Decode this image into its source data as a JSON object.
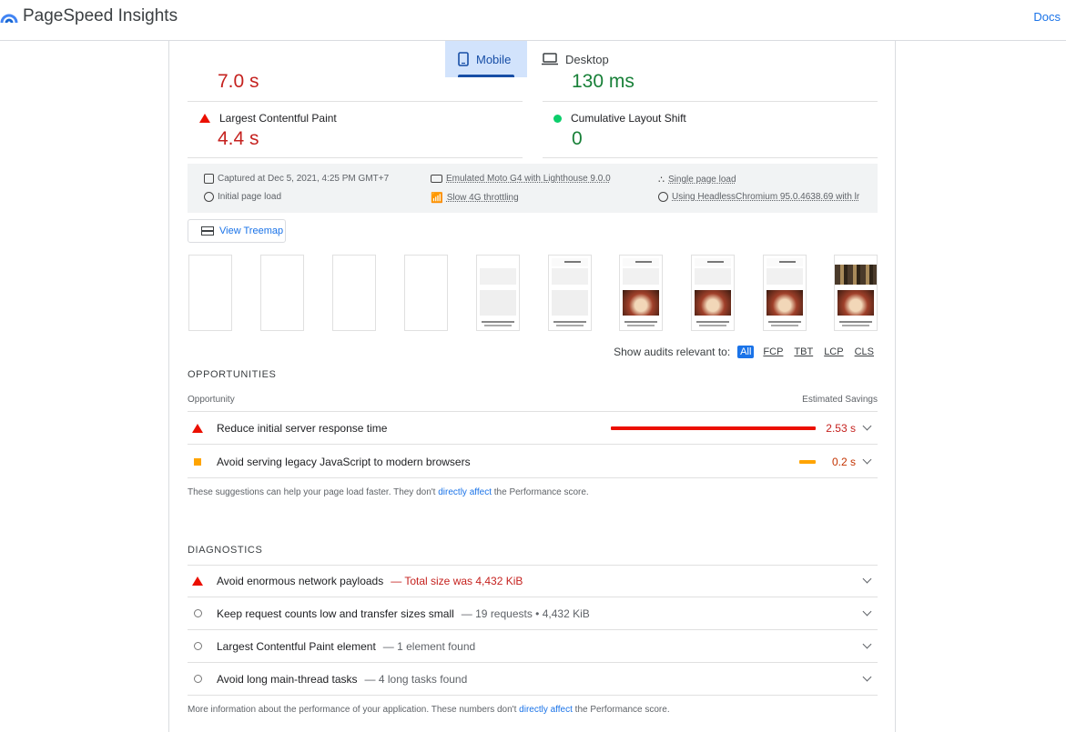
{
  "header": {
    "brand": "PageSpeed Insights",
    "docs_link": "Docs",
    "accent": "#1a73e8"
  },
  "tabs": [
    {
      "label": "Mobile",
      "icon": "phone-icon",
      "active": true
    },
    {
      "label": "Desktop",
      "icon": "laptop-icon",
      "active": false
    }
  ],
  "metrics": {
    "first_left_value": "7.0 s",
    "first_right_value": "130 ms",
    "lcp": {
      "label": "Largest Contentful Paint",
      "value": "4.4 s",
      "status": "red"
    },
    "cls": {
      "label": "Cumulative Layout Shift",
      "value": "0",
      "status": "green"
    }
  },
  "info": {
    "captured": "Captured at Dec 5, 2021, 4:25 PM GMT+7",
    "initial": "Initial page load",
    "emulated": "Emulated Moto G4 with Lighthouse 9.0.0",
    "throttling": "Slow 4G throttling",
    "single": "Single page load",
    "browser": "Using HeadlessChromium 95.0.4638.69 with lr"
  },
  "treemap_button": "View Treemap",
  "filter": {
    "label": "Show audits relevant to:",
    "options": [
      "All",
      "FCP",
      "TBT",
      "LCP",
      "CLS"
    ],
    "active": "All"
  },
  "opportunities": {
    "title": "OPPORTUNITIES",
    "col_left": "Opportunity",
    "col_right": "Estimated Savings",
    "items": [
      {
        "title": "Reduce initial server response time",
        "savings": "2.53 s",
        "severity": "red",
        "fraction": 1.0
      },
      {
        "title": "Avoid serving legacy JavaScript to modern browsers",
        "savings": "0.2 s",
        "severity": "orange",
        "fraction": 0.08
      }
    ],
    "note_before": "These suggestions can help your page load faster. They don't ",
    "note_link": "directly affect",
    "note_after": " the Performance score."
  },
  "diagnostics": {
    "title": "DIAGNOSTICS",
    "items": [
      {
        "title": "Avoid enormous network payloads",
        "sub": "— Total size was 4,432 KiB",
        "severity": "red"
      },
      {
        "title": "Keep request counts low and transfer sizes small",
        "sub": "— 19 requests • 4,432 KiB",
        "severity": "info"
      },
      {
        "title": "Largest Contentful Paint element",
        "sub": "— 1 element found",
        "severity": "info"
      },
      {
        "title": "Avoid long main-thread tasks",
        "sub": "— 4 long tasks found",
        "severity": "info"
      }
    ],
    "note_before": "More information about the performance of your application. These numbers don't ",
    "note_link": "directly affect",
    "note_after": " the Performance score."
  }
}
